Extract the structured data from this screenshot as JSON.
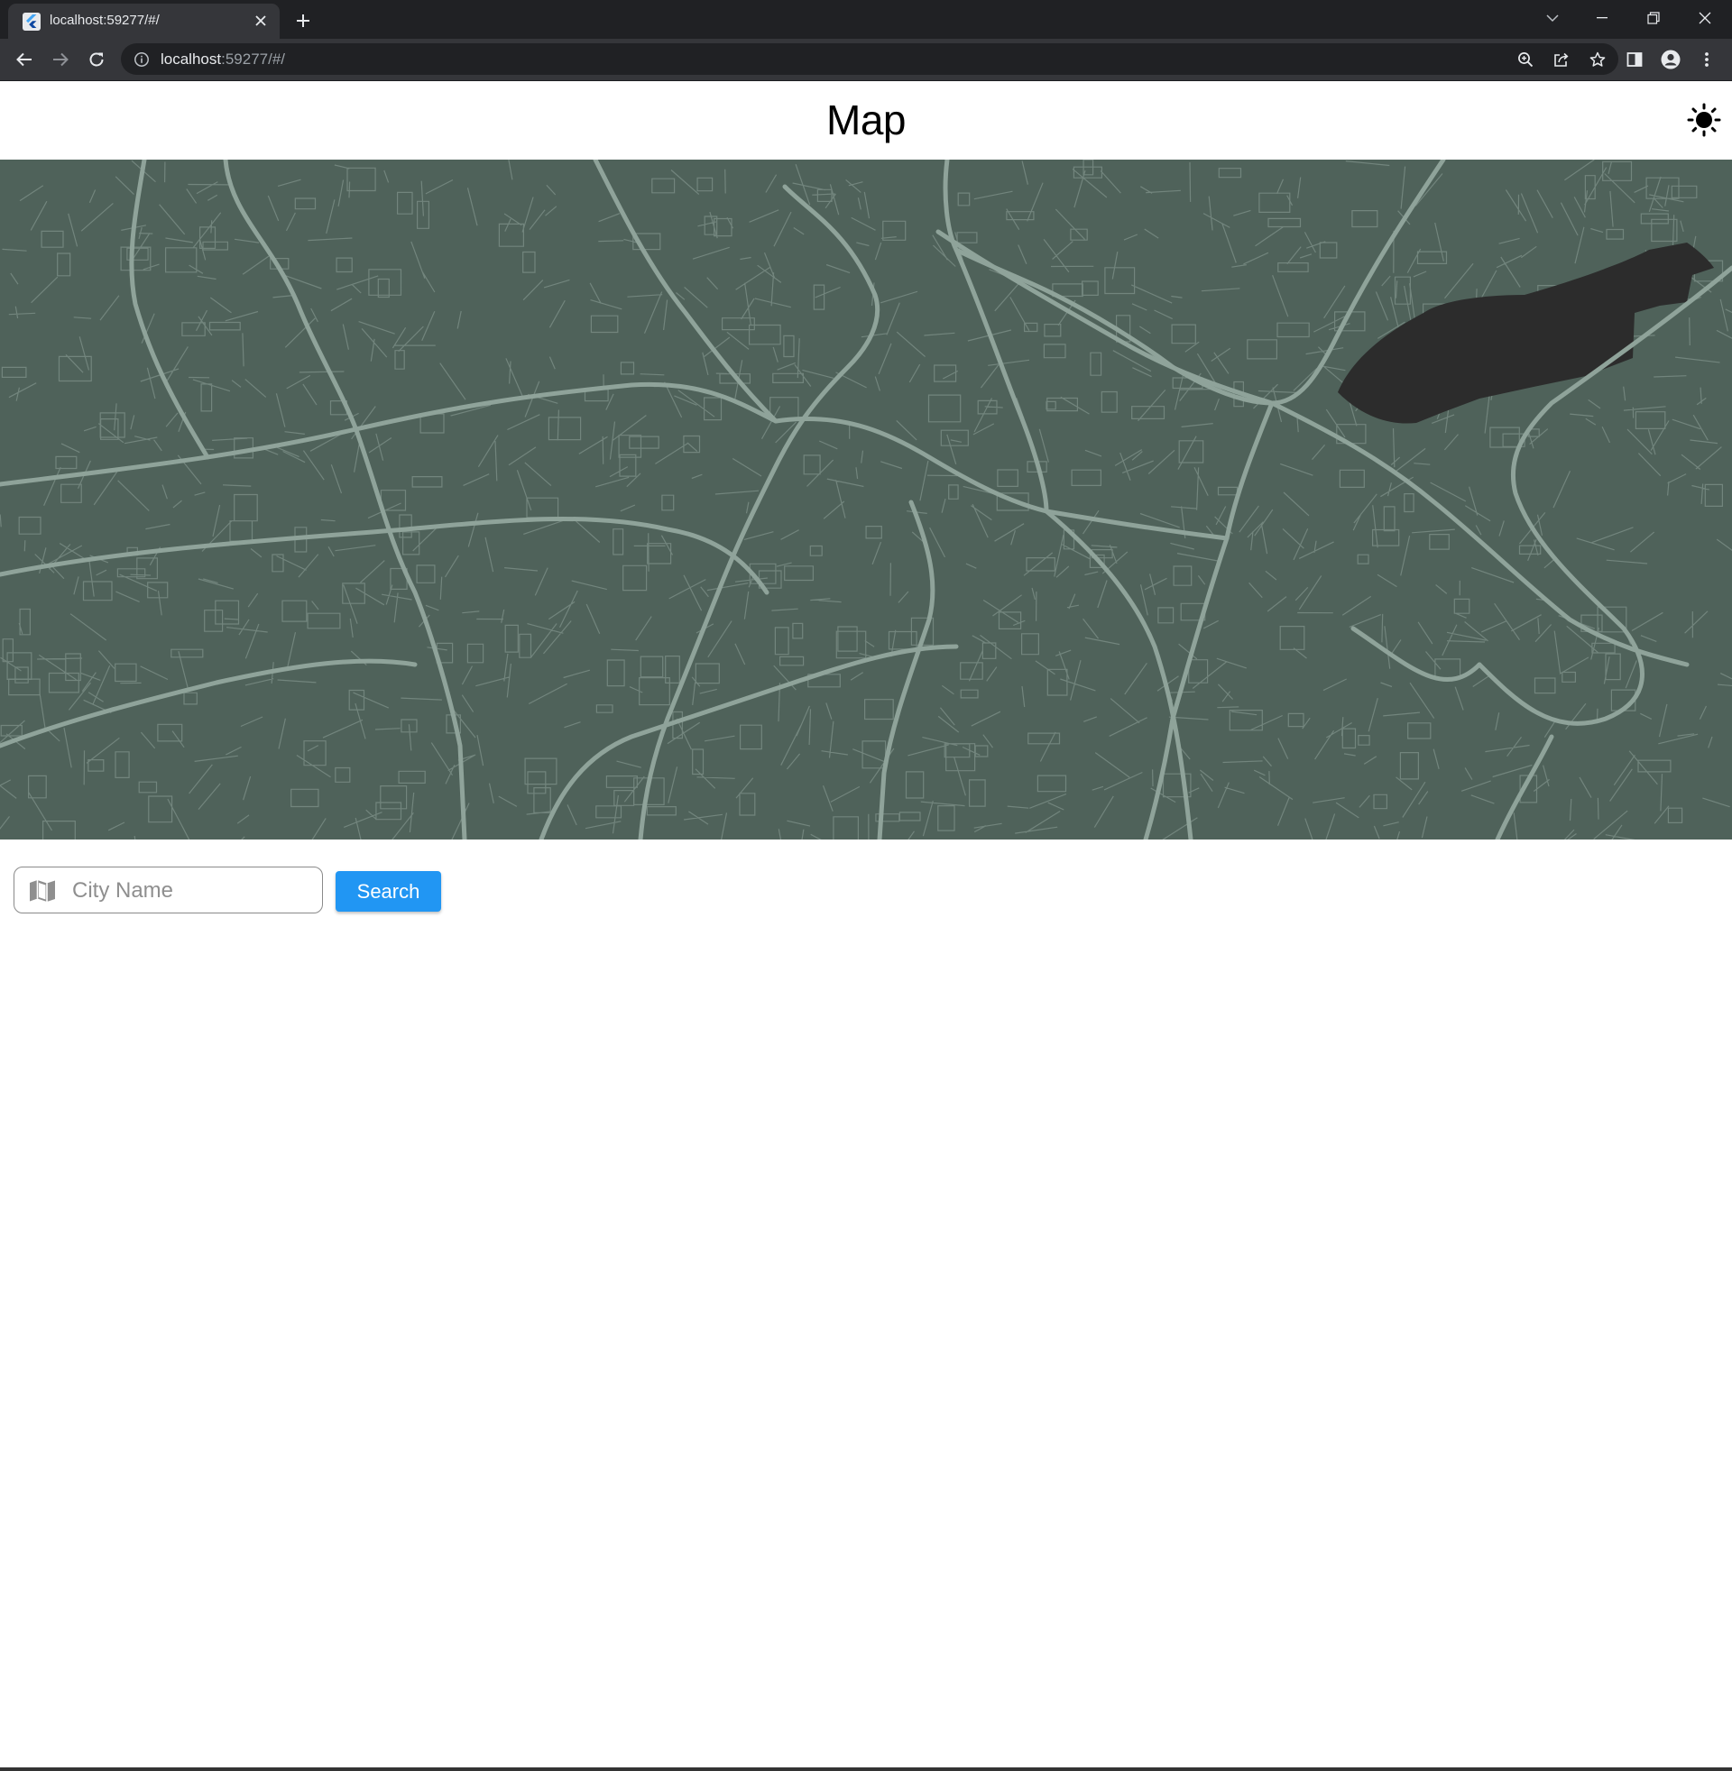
{
  "browser": {
    "tab": {
      "title": "localhost:59277/#/",
      "favicon": "flutter-logo-icon"
    },
    "address": {
      "host": "localhost",
      "rest": ":59277/#/"
    }
  },
  "app": {
    "title": "Map",
    "theme_toggle_icon": "sun-icon"
  },
  "map": {
    "land_color": "#4f625a",
    "road_color": "#8fa39a",
    "dark_area_color": "#2c2c2c"
  },
  "search": {
    "placeholder": "City Name",
    "value": "",
    "button_label": "Search",
    "button_color": "#2196f3"
  }
}
